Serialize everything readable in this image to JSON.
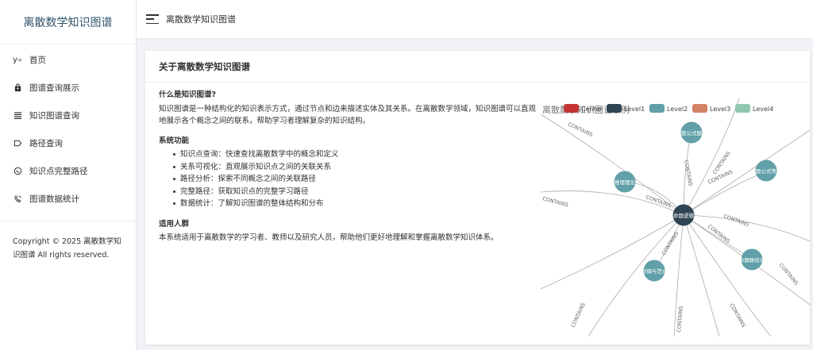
{
  "sidebar": {
    "brand": "离散数学知识图谱",
    "items": [
      {
        "label": "首页",
        "icon": "home-icon"
      },
      {
        "label": "图谱查询展示",
        "icon": "bag-icon"
      },
      {
        "label": "知识图谱查询",
        "icon": "list-icon"
      },
      {
        "label": "路径查询",
        "icon": "tag-icon"
      },
      {
        "label": "知识点完整路径",
        "icon": "chat-icon"
      },
      {
        "label": "图谱数据统计",
        "icon": "phone-icon"
      }
    ],
    "copyright": "Copyright © 2025 离散数学知识图谱 All rights reserved."
  },
  "topbar": {
    "title": "离散数学知识图谱"
  },
  "card": {
    "title": "关于离散数学知识图谱",
    "sections": {
      "what": {
        "title": "什么是知识图谱?",
        "body": "知识图谱是一种结构化的知识表示方式，通过节点和边来描述实体及其关系。在离散数学领域，知识图谱可以直观地展示各个概念之间的联系，帮助学习者理解复杂的知识结构。"
      },
      "features": {
        "title": "系统功能",
        "items": [
          "知识点查询：快速查找离散数学中的概念和定义",
          "关系可视化：直观展示知识点之间的关联关系",
          "路径分析：探索不同概念之间的关联路径",
          "完整路径：获取知识点的完整学习路径",
          "数据统计：了解知识图谱的整体结构和分布"
        ]
      },
      "audience": {
        "title": "适用人群",
        "body": "本系统适用于离散数学的学习者、教师以及研究人员，帮助他们更好地理解和掌握离散数学知识体系。"
      }
    },
    "graph": {
      "title": "离散数学知识图谱示例",
      "legend": [
        {
          "name": "Center",
          "color": "#c23531"
        },
        {
          "name": "Level1",
          "color": "#2f4554"
        },
        {
          "name": "Level2",
          "color": "#61a0a8"
        },
        {
          "name": "Level3",
          "color": "#d48265"
        },
        {
          "name": "Level4",
          "color": "#91c7ae"
        }
      ],
      "edge_label": "CONTAINS",
      "nodes": {
        "center": "命题逻辑",
        "n1": "题公式题",
        "n2": "推理理论",
        "n3": "题公式等",
        "n4": "命题联结词",
        "n5": "对偶与范式"
      },
      "colors": {
        "level1": "#2f4554",
        "level2": "#61a0a8",
        "edge": "#aaaaaa"
      }
    }
  }
}
